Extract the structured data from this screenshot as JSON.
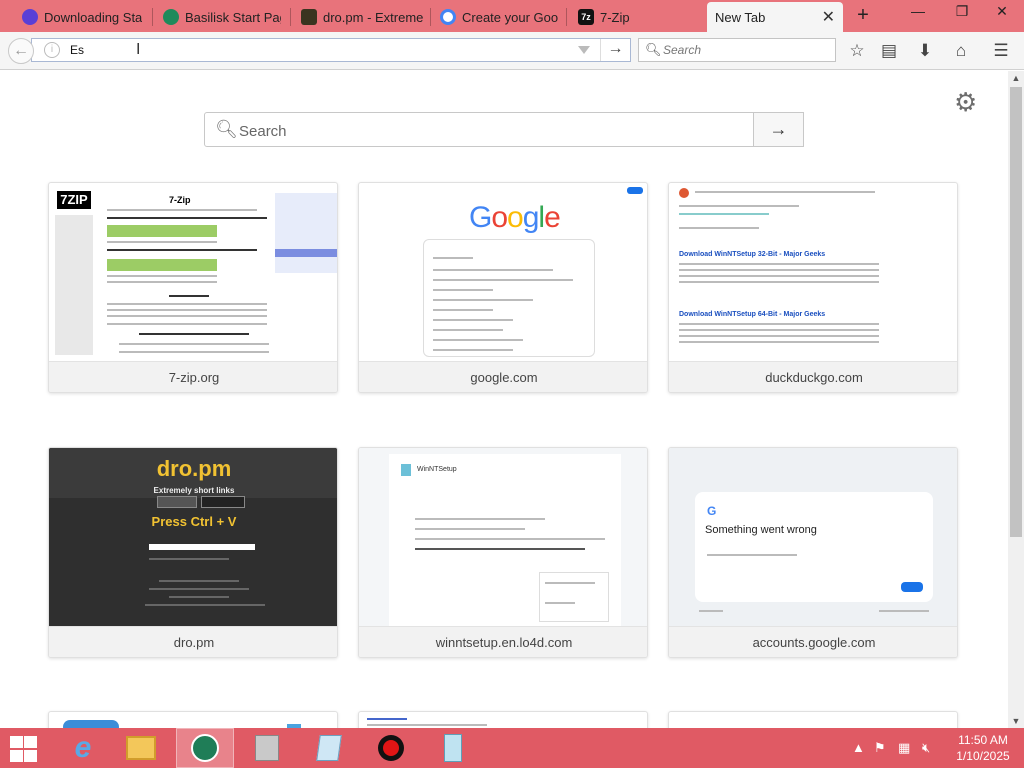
{
  "tabs": [
    {
      "label": "Downloading Sta",
      "favicon_color": "#5a3fd6"
    },
    {
      "label": "Basilisk Start Page",
      "favicon_color": "#1f8a5b"
    },
    {
      "label": "dro.pm - Extreme",
      "favicon_color": "#3a3420"
    },
    {
      "label": "Create your Goog",
      "favicon_color": "#4285f4"
    },
    {
      "label": "7-Zip",
      "favicon_color": "#111111"
    },
    {
      "label": "New Tab",
      "active": true
    }
  ],
  "window_controls": {
    "minimize": "—",
    "restore": "❐",
    "close": "✕"
  },
  "navbar": {
    "url_value": "Es",
    "search_placeholder": "Search"
  },
  "newtab": {
    "search_placeholder": "Search",
    "tiles": [
      {
        "label": "7-zip.org"
      },
      {
        "label": "google.com"
      },
      {
        "label": "duckduckgo.com"
      },
      {
        "label": "dro.pm"
      },
      {
        "label": "winntsetup.en.lo4d.com"
      },
      {
        "label": "accounts.google.com"
      }
    ],
    "thumb_text": {
      "sevenzip_logo": "7ZIP",
      "sevenzip_title": "7-Zip",
      "google_word": "Google",
      "dro_title": "dro.pm",
      "dro_sub": "Extremely short links",
      "dro_ctrl": "Press Ctrl + V",
      "ddg_link1": "Download WinNTSetup 32-Bit - Major Geeks",
      "ddg_link2": "Download WinNTSetup 64-Bit - Major Geeks",
      "lo4d_title": "WinNTSetup",
      "acct_title": "Something went wrong"
    }
  },
  "taskbar": {
    "clock_time": "11:50 AM",
    "clock_date": "1/10/2025",
    "apps": [
      "internet-explorer",
      "file-explorer",
      "basilisk",
      "installer",
      "notepad",
      "recorder",
      "7zip-sfx"
    ]
  },
  "colors": {
    "titlebar": "#e8737b",
    "taskbar": "#e05a64"
  }
}
